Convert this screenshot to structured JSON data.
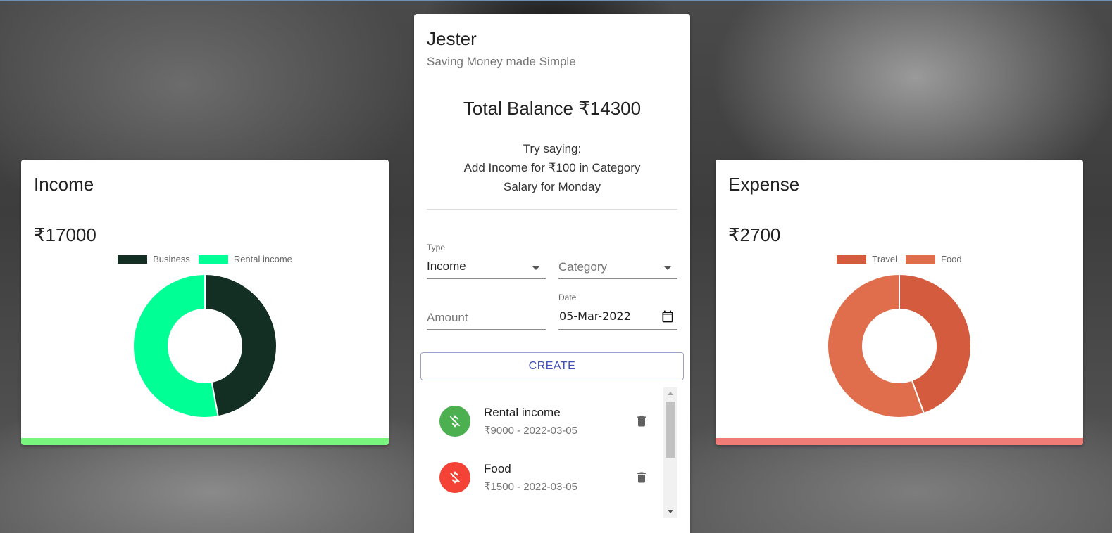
{
  "app": {
    "title": "Jester",
    "subtitle": "Saving Money made Simple",
    "balance_text": "Total Balance ₹14300",
    "hint_line1": "Try saying:",
    "hint_line2": "Add Income for ₹100 in Category",
    "hint_line3": "Salary for Monday"
  },
  "form": {
    "type_label": "Type",
    "type_value": "Income",
    "category_placeholder": "Category",
    "amount_placeholder": "Amount",
    "date_label": "Date",
    "date_value": "05-Mar-2022",
    "create_label": "CREATE"
  },
  "transactions": [
    {
      "title": "Rental income",
      "subtitle": "₹9000 - 2022-03-05",
      "kind": "income",
      "color": "#4caf50",
      "icon": "money-off-icon"
    },
    {
      "title": "Food",
      "subtitle": "₹1500 - 2022-03-05",
      "kind": "expense",
      "color": "#f44336",
      "icon": "money-off-icon"
    }
  ],
  "income": {
    "title": "Income",
    "amount": "₹17000",
    "bar_color": "#78f57c",
    "chart_data": {
      "type": "pie",
      "donut": true,
      "categories": [
        "Business",
        "Rental income"
      ],
      "values": [
        8000,
        9000
      ],
      "colors": [
        "#132e22",
        "#00ff94"
      ],
      "legend_position": "top"
    }
  },
  "expense": {
    "title": "Expense",
    "amount": "₹2700",
    "bar_color": "#f07c78",
    "chart_data": {
      "type": "pie",
      "donut": true,
      "categories": [
        "Travel",
        "Food"
      ],
      "values": [
        1200,
        1500
      ],
      "colors": [
        "#d55b3e",
        "#e06e4d"
      ],
      "legend_position": "top"
    }
  }
}
